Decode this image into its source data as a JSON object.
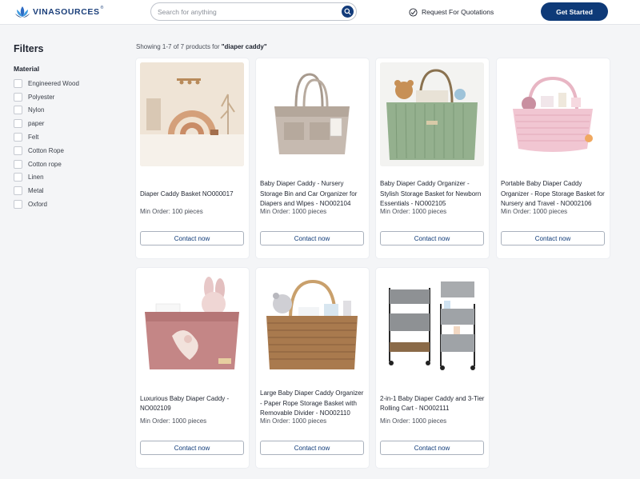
{
  "header": {
    "logo_text": "VINASOURCES",
    "logo_reg": "®",
    "search_placeholder": "Search for anything",
    "search_icon": "search-icon",
    "rfq_label": "Request For Quotations",
    "rfq_icon": "quote-icon",
    "get_started_label": "Get Started",
    "brand_color": "#0e3a78"
  },
  "sidebar": {
    "title": "Filters",
    "material_label": "Material",
    "materials": [
      "Engineered Wood",
      "Polyester",
      "Nylon",
      "paper",
      "Felt",
      "Cotton Rope",
      "Cotton rope",
      "Linen",
      "Metal",
      "Oxford"
    ]
  },
  "results": {
    "prefix": "Showing 1-7 of 7 products for ",
    "query": "\"diaper caddy\""
  },
  "products": [
    {
      "title": "Diaper Caddy Basket NO000017",
      "min_order": "Min Order: 100 pieces",
      "contact": "Contact now"
    },
    {
      "title": "Baby Diaper Caddy - Nursery Storage Bin and Car Organizer for Diapers and Wipes - NO002104",
      "min_order": "Min Order: 1000 pieces",
      "contact": "Contact now"
    },
    {
      "title": "Baby Diaper Caddy Organizer - Stylish Storage Basket for Newborn Essentials - NO002105",
      "min_order": "Min Order: 1000 pieces",
      "contact": "Contact now"
    },
    {
      "title": "Portable Baby Diaper Caddy Organizer - Rope Storage Basket for Nursery and Travel - NO002106",
      "min_order": "Min Order: 1000 pieces",
      "contact": "Contact now"
    },
    {
      "title": "Luxurious Baby Diaper Caddy - NO002109",
      "min_order": "Min Order: 1000 pieces",
      "contact": "Contact now"
    },
    {
      "title": "Large Baby Diaper Caddy Organizer - Paper Rope Storage Basket with Removable Divider - NO002110",
      "min_order": "Min Order: 1000 pieces",
      "contact": "Contact now"
    },
    {
      "title": "2-in-1 Baby Diaper Caddy and 3-Tier Rolling Cart - NO002111",
      "min_order": "Min Order: 1000 pieces",
      "contact": "Contact now"
    }
  ]
}
